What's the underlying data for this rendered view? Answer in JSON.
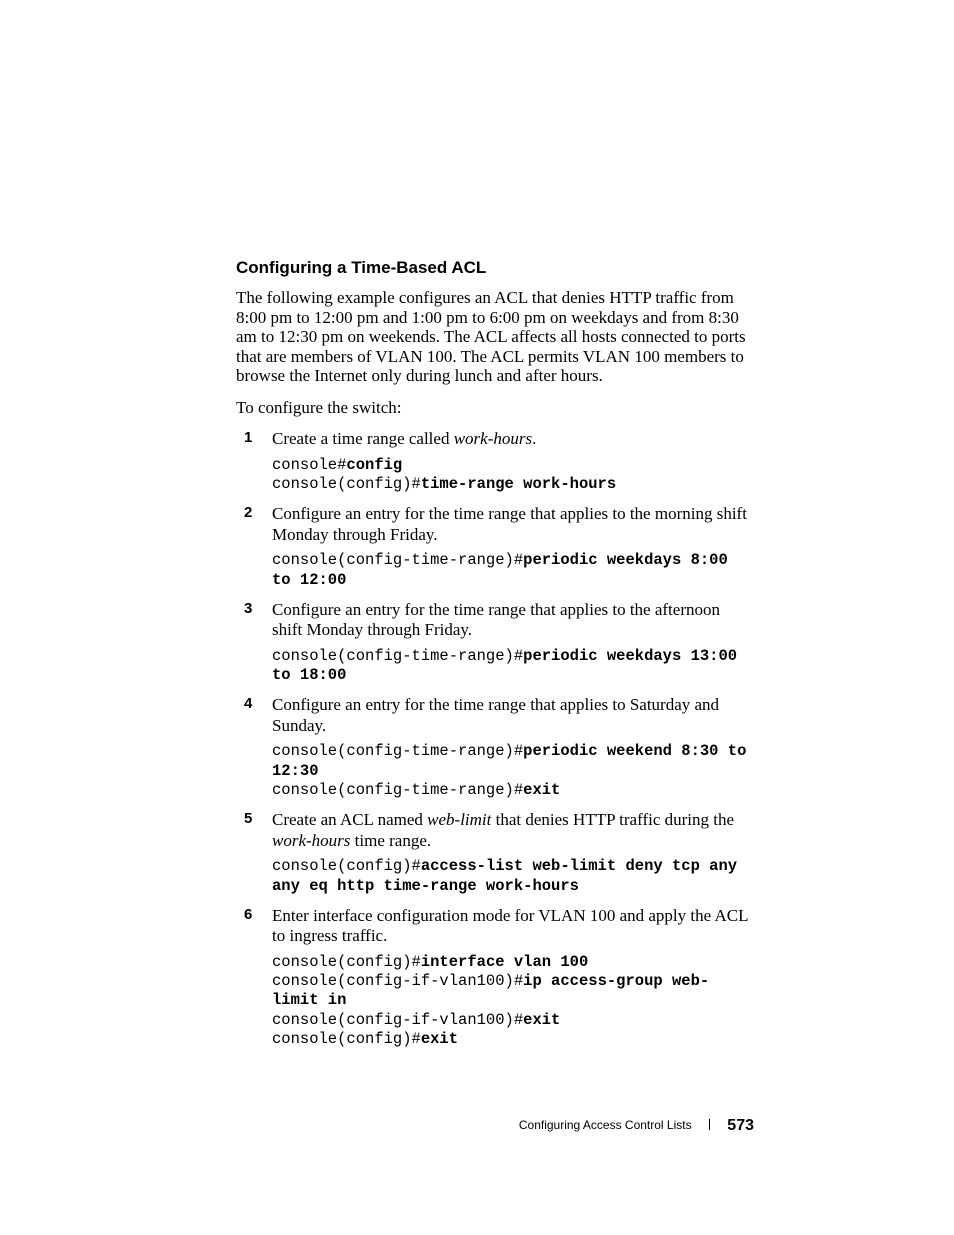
{
  "heading": "Configuring a Time-Based ACL",
  "intro": "The following example configures an ACL that denies HTTP traffic from 8:00 pm to 12:00 pm and 1:00 pm to 6:00 pm on weekdays and from 8:30 am to 12:30 pm on weekends. The ACL affects all hosts connected to ports that are members of VLAN 100. The ACL permits VLAN 100 members to browse the Internet only during lunch and after hours.",
  "lead_in": "To configure the switch:",
  "steps": {
    "s1": {
      "text_pre": "Create a time range called ",
      "italic": "work-hours",
      "text_post": ".",
      "line1_plain": "console#",
      "line1_bold": "config",
      "line2_plain": "console(config)#",
      "line2_bold": "time-range work-hours"
    },
    "s2": {
      "text": "Configure an entry for the time range that applies to the morning shift Monday through Friday.",
      "line1_plain": "console(config-time-range)#",
      "line1_bold": "periodic weekdays 8:00 to 12:00"
    },
    "s3": {
      "text": "Configure an entry for the time range that applies to the afternoon shift Monday through Friday.",
      "line1_plain": "console(config-time-range)#",
      "line1_bold": "periodic weekdays 13:00 to 18:00"
    },
    "s4": {
      "text": "Configure an entry for the time range that applies to Saturday and Sunday.",
      "line1_plain": "console(config-time-range)#",
      "line1_bold": "periodic weekend 8:30 to 12:30",
      "line2_plain": "console(config-time-range)#",
      "line2_bold": "exit"
    },
    "s5": {
      "text_a": "Create an ACL named ",
      "italic_a": "web-limit",
      "text_b": " that denies HTTP traffic during the ",
      "italic_b": "work-hours",
      "text_c": " time range.",
      "line1_plain": "console(config)#",
      "line1_bold": "access-list web-limit deny tcp any any eq http time-range work-hours"
    },
    "s6": {
      "text": "Enter interface configuration mode for VLAN 100 and apply the ACL to ingress traffic.",
      "l1p": "console(config)#",
      "l1b": "interface vlan 100",
      "l2p": "console(config-if-vlan100)#",
      "l2b": "ip access-group web-limit in",
      "l3p": "console(config-if-vlan100)#",
      "l3b": "exit",
      "l4p": "console(config)#",
      "l4b": "exit"
    }
  },
  "footer": {
    "title": "Configuring Access Control Lists",
    "page": "573"
  }
}
